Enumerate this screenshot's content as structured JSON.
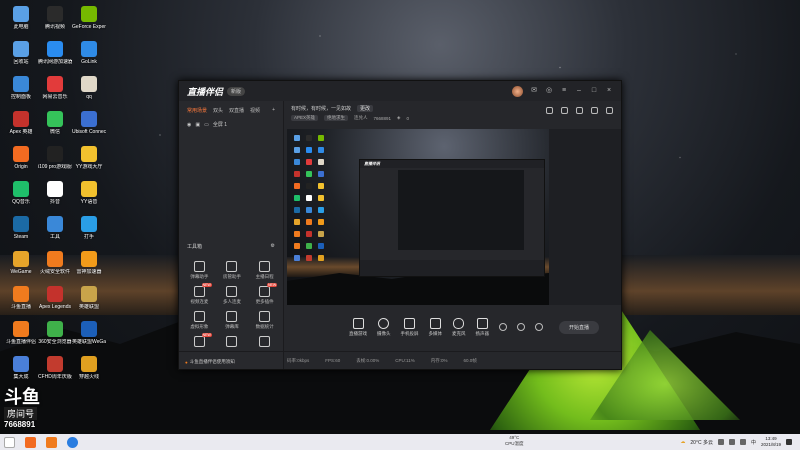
{
  "desktop_icons": [
    {
      "label": "此电脑",
      "color": "#5aa0e6"
    },
    {
      "label": "腾讯视频",
      "color": "#2b2b2b"
    },
    {
      "label": "GeForce Experience",
      "color": "#76b900"
    },
    {
      "label": "回收站",
      "color": "#5aa0e6"
    },
    {
      "label": "腾讯网游加速器",
      "color": "#2a8cf0"
    },
    {
      "label": "GoLink",
      "color": "#2f8be6"
    },
    {
      "label": "控制面板",
      "color": "#3a88d8"
    },
    {
      "label": "网易云音乐",
      "color": "#e23b3b"
    },
    {
      "label": "qq",
      "color": "#e0d8c8"
    },
    {
      "label": "Apex 英雄",
      "color": "#c4322c"
    },
    {
      "label": "微信",
      "color": "#35c35a"
    },
    {
      "label": "Ubisoft Connect",
      "color": "#3b6fd1"
    },
    {
      "label": "Origin",
      "color": "#f26b21"
    },
    {
      "label": "i109 pro游戏版驱动",
      "color": "#222222"
    },
    {
      "label": "YY游戏大厅",
      "color": "#f2c12e"
    },
    {
      "label": "QQ音乐",
      "color": "#1fbf6a"
    },
    {
      "label": "抖音",
      "color": "#ffffff"
    },
    {
      "label": "YY语音",
      "color": "#f2c12e"
    },
    {
      "label": "Steam",
      "color": "#1b6aa5"
    },
    {
      "label": "工具",
      "color": "#3a88d8"
    },
    {
      "label": "打手",
      "color": "#2a9ee6"
    },
    {
      "label": "WeGame",
      "color": "#e6a42a"
    },
    {
      "label": "火绒安全软件",
      "color": "#f07b1e"
    },
    {
      "label": "雷神加速器",
      "color": "#f29b1a"
    },
    {
      "label": "斗鱼直播",
      "color": "#f07b1e"
    },
    {
      "label": "Apex Legends",
      "color": "#c4322c"
    },
    {
      "label": "英雄联盟",
      "color": "#c9a44a"
    },
    {
      "label": "斗鱼直播伴侣",
      "color": "#f07b1e"
    },
    {
      "label": "360安全浏览器",
      "color": "#3fb14a"
    },
    {
      "label": "英雄联盟WeGame版",
      "color": "#1c5fb8"
    },
    {
      "label": "集大成",
      "color": "#4a7fd8"
    },
    {
      "label": "CFHD周年庆版大区",
      "color": "#c23b2e"
    },
    {
      "label": "穿越火线",
      "color": "#e0a020"
    }
  ],
  "watermark": {
    "logo": "斗鱼",
    "room_label": "房间号",
    "room_number": "7668891"
  },
  "window": {
    "brand": "直播伴侣",
    "version_badge": "新版",
    "left_tabs": [
      "常用场景",
      "双头",
      "双直播",
      "视频"
    ],
    "scene_label": "全屏 1",
    "tools_title": "工具箱",
    "tools": [
      {
        "label": "弹幕助手",
        "badge": ""
      },
      {
        "label": "房管助手",
        "badge": ""
      },
      {
        "label": "主播日程",
        "badge": ""
      },
      {
        "label": "视频连麦",
        "badge": "NEW"
      },
      {
        "label": "多人连麦",
        "badge": ""
      },
      {
        "label": "更多插件",
        "badge": "NEW"
      },
      {
        "label": "虚拟形象",
        "badge": ""
      },
      {
        "label": "弹幕库",
        "badge": ""
      },
      {
        "label": "数据统计",
        "badge": ""
      },
      {
        "label": "",
        "badge": "NEW"
      },
      {
        "label": "",
        "badge": ""
      },
      {
        "label": "",
        "badge": ""
      }
    ],
    "bottom_notice": "斗鱼直播伴侣使用须知",
    "top_notice": "有时候，有时候，一见如故",
    "top_notice_tag": "更改",
    "meta_tag": "APEX英雄",
    "meta_sub": "绝地求生",
    "meta_status": "连兑人",
    "meta_id": "7668891",
    "meta_count": "0",
    "controls": [
      "直播游戏",
      "摄像头",
      "手机投屏",
      "多媒体",
      "麦克风",
      "扬声器"
    ],
    "start_button": "开始直播",
    "status_items": [
      "码率:0kbps",
      "FPS:60",
      "丢帧:0.00%",
      "CPU:11%",
      "内存:0%",
      "60.0帧"
    ]
  },
  "taskbar": {
    "temp": "49°C",
    "cpu_label": "CPU温度",
    "weather": "20°C 多云",
    "time": "13:49",
    "date": "2021/8/19",
    "ime": "中"
  }
}
